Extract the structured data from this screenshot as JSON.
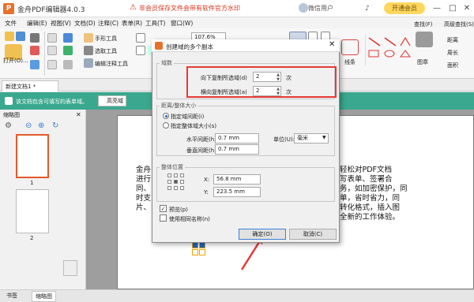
{
  "app": {
    "title": "金舟PDF编辑器4.0.3",
    "warning": "非会员保存文件会带有软件官方水印",
    "user": "微信用户",
    "vip_button": "开通会员"
  },
  "menu": [
    "文件",
    "编辑(E)",
    "视图(V)",
    "文档(D)",
    "注释(C)",
    "表单(R)",
    "工具(T)",
    "窗口(W)"
  ],
  "ribbon": {
    "open": "打开(O)...",
    "hand_tool": "手形工具",
    "select_tool": "选取工具",
    "edit_annot_tool": "编辑注释工具",
    "zoom": "107.6%",
    "lines": "线条",
    "stamp": "图章",
    "search": "查找(F)",
    "advanced_search": "高级查找(S)",
    "distance": "距离",
    "perimeter": "周长",
    "area": "面积"
  },
  "doc_tab": "新建文档1 *",
  "form_bar": {
    "message": "该文档包含可填写的表单域。",
    "highlight": "高亮域"
  },
  "sidebar": {
    "title": "缩略图",
    "pages": [
      "1",
      "2"
    ]
  },
  "bottom_tabs": [
    "书签",
    "缩略图"
  ],
  "document": {
    "text_left": [
      "金舟",
      "进行",
      "同、",
      "时支",
      "片、"
    ],
    "text_right": [
      "轻松对PDF文档",
      "写表单、签署合",
      "务，如加密保护，同",
      "单，省时省力，同",
      "转化格式，插入图",
      "全新的工作体验。"
    ]
  },
  "dialog": {
    "title": "创建域的多个副本",
    "section_fields": "域数",
    "down_label": "向下复制所选域(d)",
    "down_value": "2",
    "across_label": "横向复制所选域(a)",
    "across_value": "2",
    "unit_times": "次",
    "section_spacing": "距离/整体大小",
    "radio_spacing": "指定域间距(i)",
    "radio_size": "指定整体域大小(s)",
    "h_spacing_label": "水平间距(h)",
    "h_spacing_value": "0.7 mm",
    "v_spacing_label": "垂直间距(h)",
    "v_spacing_value": "0.7 mm",
    "unit_label": "单位(U):",
    "unit_value": "毫米",
    "section_position": "整体位置",
    "x_label": "X:",
    "x_value": "56.8 mm",
    "y_label": "Y:",
    "y_value": "223.5 mm",
    "preview": "预览(p)",
    "same_name": "使用相同名称(n)",
    "ok": "确定(O)",
    "cancel": "取消(C)"
  },
  "colors": {
    "accent": "#e8702a",
    "form_bar": "#3aa88e",
    "highlight_box": "#e53935",
    "vip": "#ffd75e"
  }
}
